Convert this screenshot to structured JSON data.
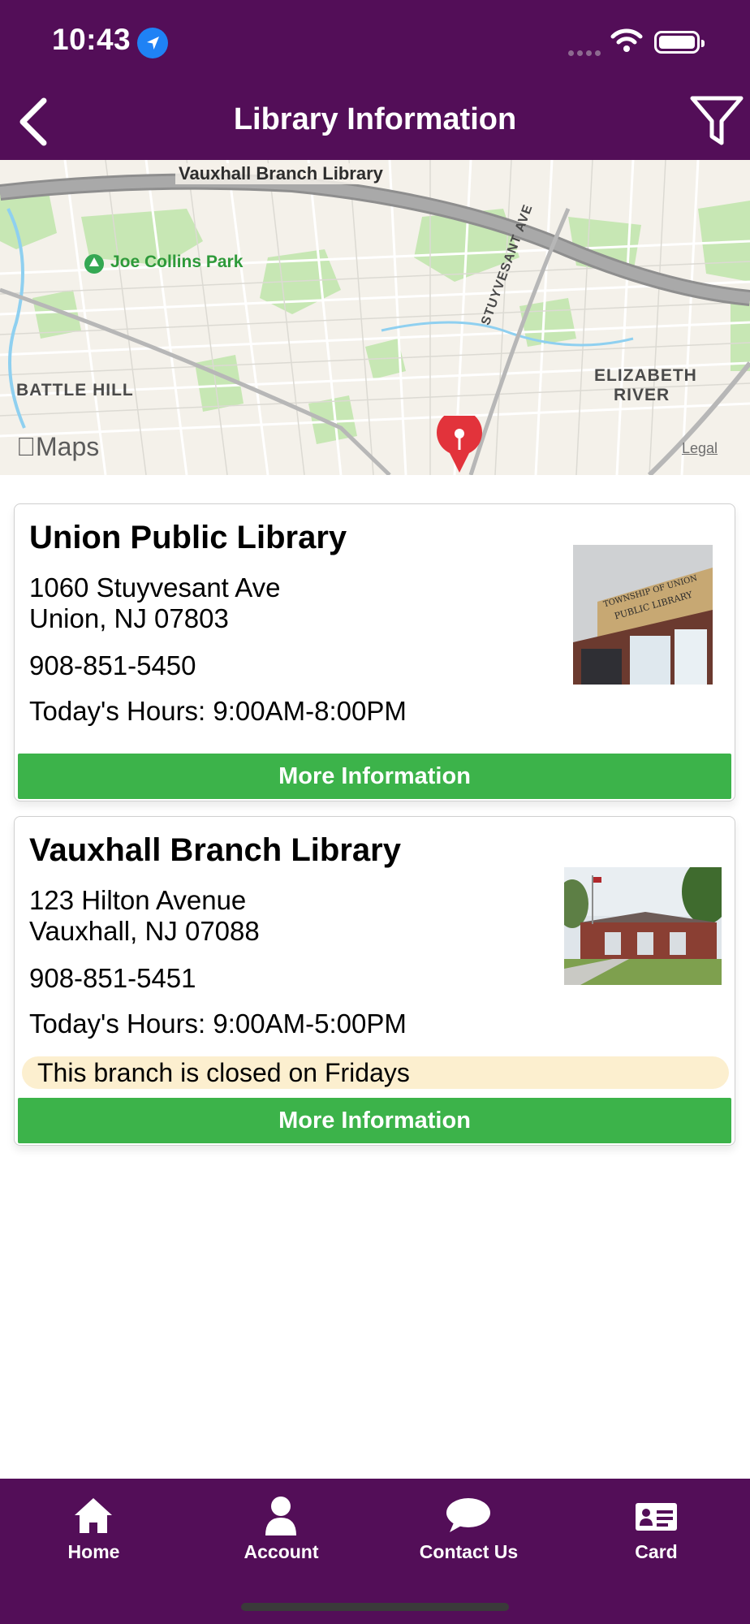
{
  "status_bar": {
    "time": "10:43",
    "icons": [
      "location-arrow-icon",
      "signal-icon",
      "wifi-icon",
      "battery-icon"
    ]
  },
  "header": {
    "title": "Library Information",
    "back_icon": "chevron-left-icon",
    "filter_icon": "filter-icon"
  },
  "map": {
    "labels": {
      "top": "Vauxhall Branch Library",
      "park": "Joe Collins Park",
      "battle_hill": "BATTLE HILL",
      "elizabeth_river_1": "ELIZABETH",
      "elizabeth_river_2": "RIVER",
      "street": "STUYVESANT AVE"
    },
    "attribution": "Maps",
    "legal": "Legal"
  },
  "libraries": [
    {
      "name": "Union Public Library",
      "address_line1": "1060 Stuyvesant Ave",
      "address_line2": "Union, NJ 07803",
      "phone": "908-851-5450",
      "hours": "Today's Hours: 9:00AM-8:00PM",
      "image_sign_1": "TOWNSHIP OF UNION",
      "image_sign_2": "PUBLIC LIBRARY",
      "button": "More Information"
    },
    {
      "name": "Vauxhall Branch Library",
      "address_line1": "123 Hilton Avenue",
      "address_line2": "Vauxhall, NJ 07088",
      "phone": "908-851-5451",
      "hours": "Today's Hours: 9:00AM-5:00PM",
      "notice": "This branch is closed on Fridays",
      "button": "More Information"
    }
  ],
  "tabbar": {
    "items": [
      {
        "label": "Home",
        "icon": "home-icon"
      },
      {
        "label": "Account",
        "icon": "account-icon"
      },
      {
        "label": "Contact Us",
        "icon": "chat-bubble-icon"
      },
      {
        "label": "Card",
        "icon": "id-card-icon"
      }
    ]
  },
  "colors": {
    "brand_purple": "#530e58",
    "button_green": "#3cb34a",
    "notice_bg": "#fcefcf",
    "pin_red": "#e2333b"
  }
}
